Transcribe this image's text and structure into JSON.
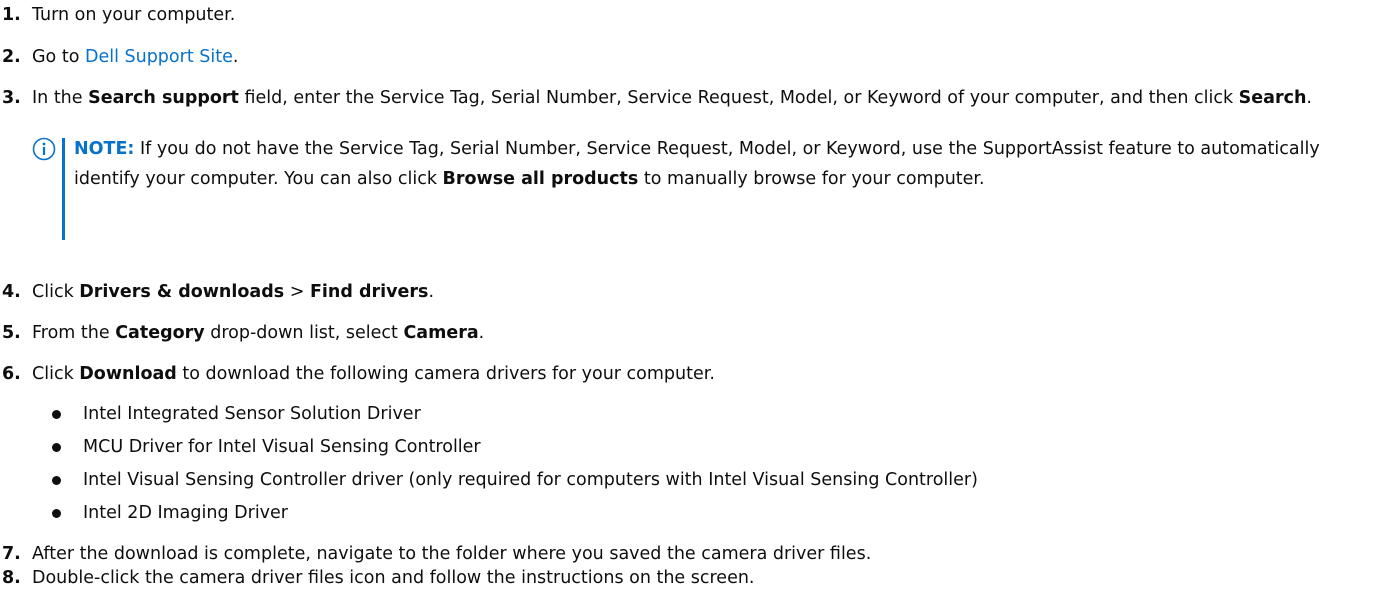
{
  "steps": [
    {
      "num": "1.",
      "text": "Turn on your computer."
    },
    {
      "num": "2.",
      "pre": "Go to ",
      "link": "Dell Support Site",
      "post": "."
    },
    {
      "num": "3.",
      "t1": "In the ",
      "b1": "Search support",
      "t2": " field, enter the Service Tag, Serial Number, Service Request, Model, or Keyword of your computer, and then click ",
      "b2": "Search",
      "t3": "."
    },
    {
      "num": "4.",
      "t1": "Click ",
      "b1": "Drivers & downloads",
      "t2": " > ",
      "b2": "Find drivers",
      "t3": "."
    },
    {
      "num": "5.",
      "t1": "From the ",
      "b1": "Category",
      "t2": " drop-down list, select ",
      "b2": "Camera",
      "t3": "."
    },
    {
      "num": "6.",
      "t1": "Click ",
      "b1": "Download",
      "t2": " to download the following camera drivers for your computer."
    },
    {
      "num": "7.",
      "text": "After the download is complete, navigate to the folder where you saved the camera driver files."
    },
    {
      "num": "8.",
      "text": "Double-click the camera driver files icon and follow the instructions on the screen."
    }
  ],
  "note": {
    "label": "NOTE:",
    "t1": " If you do not have the Service Tag, Serial Number, Service Request, Model, or Keyword, use the SupportAssist feature to automatically identify your computer. You can also click ",
    "b1": "Browse all products",
    "t2": " to manually browse for your computer."
  },
  "bullets": [
    "Intel Integrated Sensor Solution Driver",
    "MCU Driver for Intel Visual Sensing Controller",
    "Intel Visual Sensing Controller driver (only required for computers with Intel Visual Sensing Controller)",
    "Intel 2D Imaging Driver"
  ],
  "icons": {
    "note": "info-circle-icon",
    "bullet": "bullet-dot-icon"
  },
  "colors": {
    "link": "#0672cb",
    "note_accent": "#0672cb",
    "text": "#0e0e0e"
  }
}
